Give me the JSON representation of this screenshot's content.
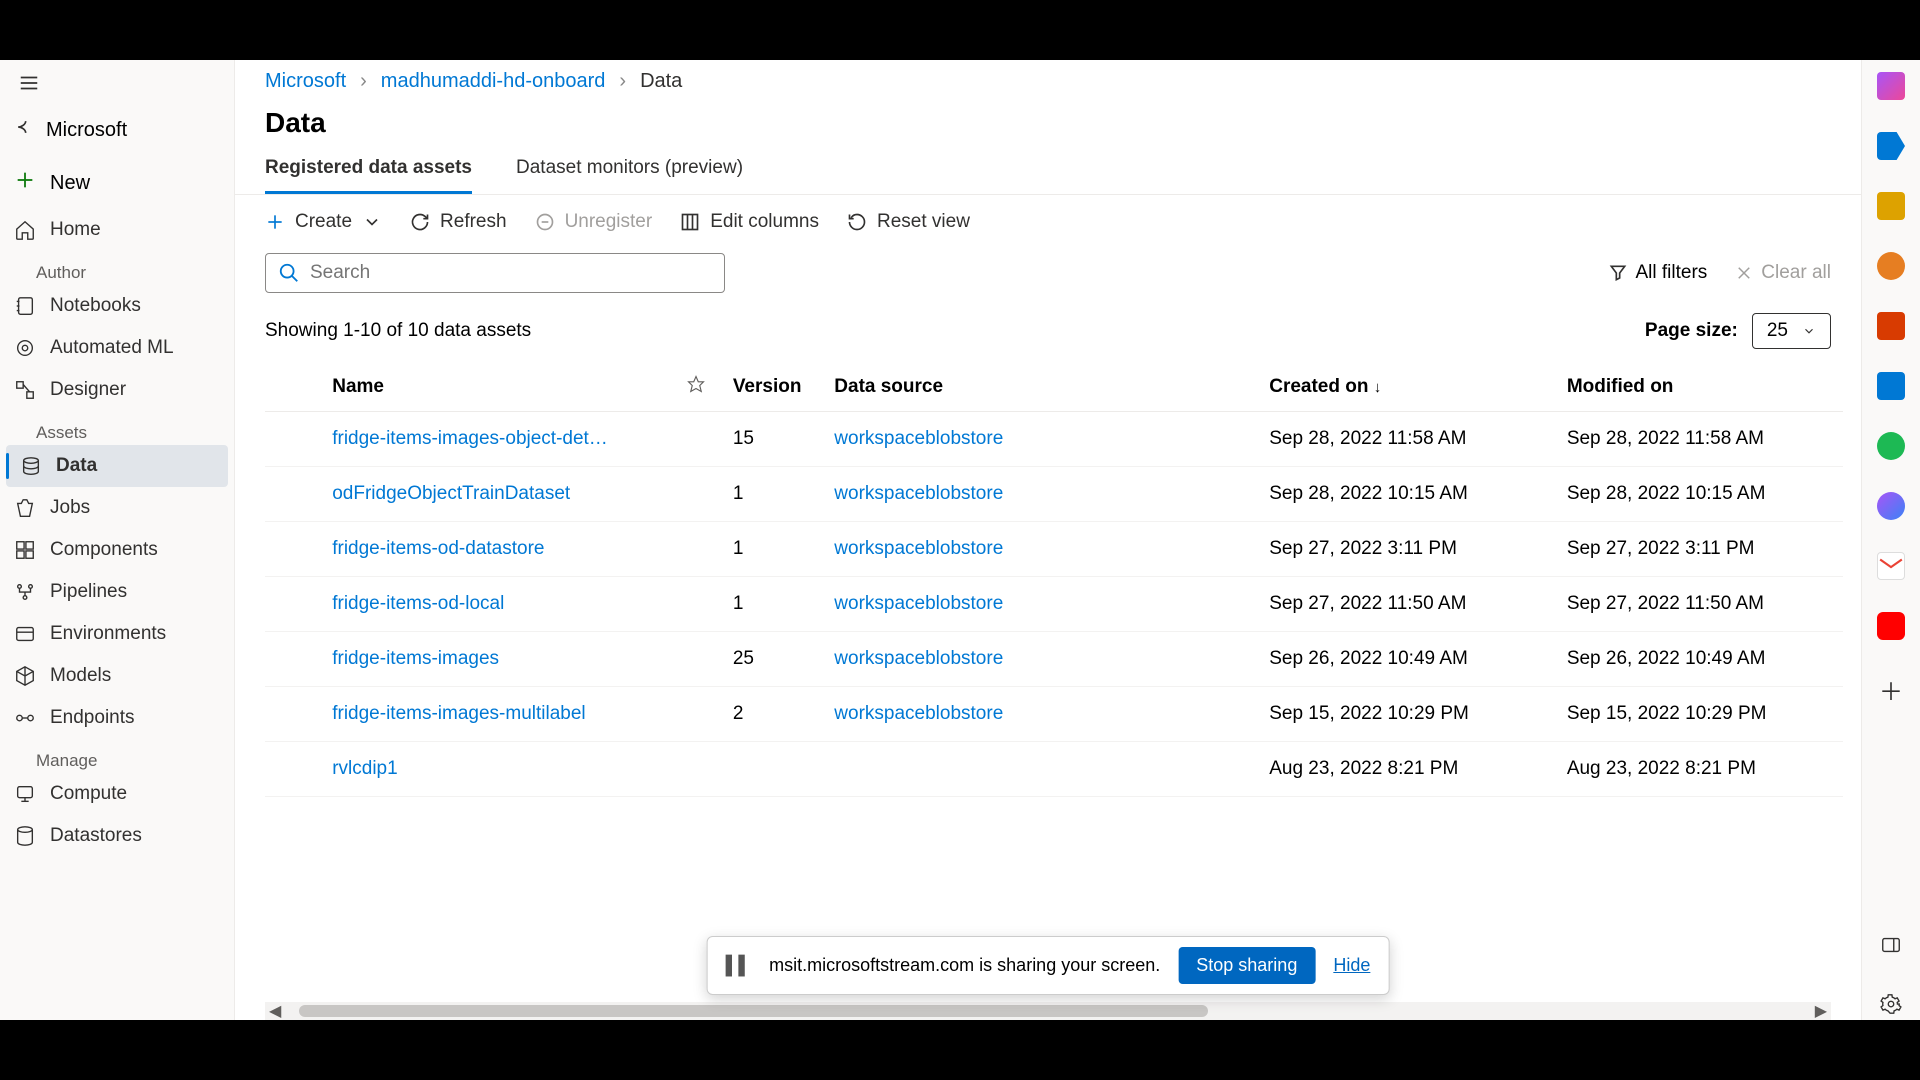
{
  "sidebar": {
    "back_label": "Microsoft",
    "new_label": "New",
    "sections": {
      "author": "Author",
      "assets": "Assets",
      "manage": "Manage"
    },
    "items": {
      "home": "Home",
      "notebooks": "Notebooks",
      "automl": "Automated ML",
      "designer": "Designer",
      "data": "Data",
      "jobs": "Jobs",
      "components": "Components",
      "pipelines": "Pipelines",
      "environments": "Environments",
      "models": "Models",
      "endpoints": "Endpoints",
      "compute": "Compute",
      "datastores": "Datastores"
    }
  },
  "breadcrumb": {
    "root": "Microsoft",
    "workspace": "madhumaddi-hd-onboard",
    "current": "Data"
  },
  "page_title": "Data",
  "tabs": {
    "registered": "Registered data assets",
    "monitors": "Dataset monitors (preview)"
  },
  "toolbar": {
    "create": "Create",
    "refresh": "Refresh",
    "unregister": "Unregister",
    "edit_columns": "Edit columns",
    "reset_view": "Reset view"
  },
  "search": {
    "placeholder": "Search"
  },
  "filters": {
    "all": "All filters",
    "clear": "Clear all"
  },
  "result_text": "Showing 1-10 of 10 data assets",
  "page_size_label": "Page size:",
  "page_size_value": "25",
  "columns": {
    "name": "Name",
    "version": "Version",
    "data_source": "Data source",
    "created_on": "Created on",
    "modified_on": "Modified on"
  },
  "rows": [
    {
      "name": "fridge-items-images-object-det…",
      "version": "15",
      "data_source": "workspaceblobstore",
      "created": "Sep 28, 2022 11:58 AM",
      "modified": "Sep 28, 2022 11:58 AM"
    },
    {
      "name": "odFridgeObjectTrainDataset",
      "version": "1",
      "data_source": "workspaceblobstore",
      "created": "Sep 28, 2022 10:15 AM",
      "modified": "Sep 28, 2022 10:15 AM"
    },
    {
      "name": "fridge-items-od-datastore",
      "version": "1",
      "data_source": "workspaceblobstore",
      "created": "Sep 27, 2022 3:11 PM",
      "modified": "Sep 27, 2022 3:11 PM"
    },
    {
      "name": "fridge-items-od-local",
      "version": "1",
      "data_source": "workspaceblobstore",
      "created": "Sep 27, 2022 11:50 AM",
      "modified": "Sep 27, 2022 11:50 AM"
    },
    {
      "name": "fridge-items-images",
      "version": "25",
      "data_source": "workspaceblobstore",
      "created": "Sep 26, 2022 10:49 AM",
      "modified": "Sep 26, 2022 10:49 AM"
    },
    {
      "name": "fridge-items-images-multilabel",
      "version": "2",
      "data_source": "workspaceblobstore",
      "created": "Sep 15, 2022 10:29 PM",
      "modified": "Sep 15, 2022 10:29 PM"
    },
    {
      "name": "rvlcdip1",
      "version": "",
      "data_source": "",
      "created": "Aug 23, 2022 8:21 PM",
      "modified": "Aug 23, 2022 8:21 PM"
    }
  ],
  "toast": {
    "text": "msit.microsoftstream.com is sharing your screen.",
    "stop": "Stop sharing",
    "hide": "Hide"
  }
}
